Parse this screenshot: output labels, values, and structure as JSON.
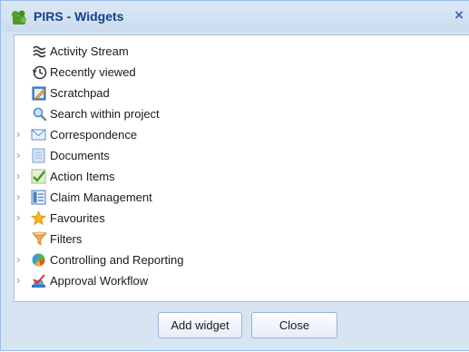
{
  "dialog": {
    "title": "PIRS - Widgets",
    "close_glyph": "×"
  },
  "tree": {
    "items": [
      {
        "label": "Activity Stream",
        "icon": "activity-stream-icon",
        "expandable": false
      },
      {
        "label": "Recently viewed",
        "icon": "recent-clock-icon",
        "expandable": false
      },
      {
        "label": "Scratchpad",
        "icon": "scratchpad-pencil-icon",
        "expandable": false
      },
      {
        "label": "Search within project",
        "icon": "search-magnifier-icon",
        "expandable": false
      },
      {
        "label": "Correspondence",
        "icon": "envelope-icon",
        "expandable": true
      },
      {
        "label": "Documents",
        "icon": "document-icon",
        "expandable": true
      },
      {
        "label": "Action Items",
        "icon": "checkmark-icon",
        "expandable": true
      },
      {
        "label": "Claim Management",
        "icon": "claim-grid-icon",
        "expandable": true
      },
      {
        "label": "Favourites",
        "icon": "star-icon",
        "expandable": true
      },
      {
        "label": "Filters",
        "icon": "funnel-icon",
        "expandable": false
      },
      {
        "label": "Controlling and Reporting",
        "icon": "pie-chart-icon",
        "expandable": true
      },
      {
        "label": "Approval Workflow",
        "icon": "approval-stamp-icon",
        "expandable": true
      }
    ]
  },
  "footer": {
    "add_label": "Add widget",
    "close_label": "Close"
  }
}
